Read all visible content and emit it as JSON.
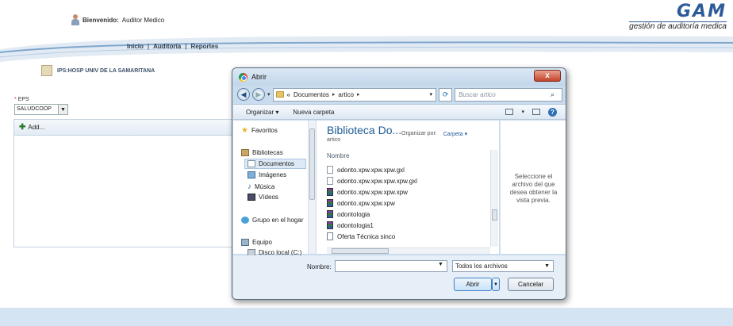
{
  "header": {
    "welcome_label": "Bienvenido:",
    "user_name": "Auditor Medico",
    "brand_logo": "GAM",
    "brand_tagline": "gestión de auditoría medica"
  },
  "nav": {
    "items": [
      "Inicio",
      "Auditoria",
      "Reportes"
    ],
    "separator": "|"
  },
  "ips": {
    "label": "IPS:HOSP UNIV DE LA SAMARITANA"
  },
  "eps": {
    "label": "EPS",
    "required_mark": "*",
    "value": "SALUDCOOP"
  },
  "panel": {
    "add_label": "Add..."
  },
  "dialog": {
    "title": "Abrir",
    "close_label": "x",
    "address": {
      "prefix": "«",
      "crumbs": [
        "Documentos",
        "artico"
      ]
    },
    "search_placeholder": "Buscar artico",
    "toolbar": {
      "organize": "Organizar ▾",
      "new_folder": "Nueva carpeta"
    },
    "nav_pane": {
      "favorites": "Favoritos",
      "libraries": "Bibliotecas",
      "documents": "Documentos",
      "images": "Imágenes",
      "music": "Música",
      "videos": "Vídeos",
      "homegroup": "Grupo en el hogar",
      "computer": "Equipo",
      "local_disk": "Disco local (C:)"
    },
    "library": {
      "title": "Biblioteca Do...",
      "subtitle": "artico",
      "arrange_label": "Organizar por:",
      "arrange_value": "Carpeta ▾"
    },
    "column_header": "Nombre",
    "files": [
      {
        "name": "odonto.xpw.xpw.xpw.gxl",
        "type": "doc"
      },
      {
        "name": "odonto.xpw.xpw.xpw.xpw.gxl",
        "type": "doc"
      },
      {
        "name": "odonto.xpw.xpw.xpw.xpw",
        "type": "rar"
      },
      {
        "name": "odonto.xpw.xpw.xpw",
        "type": "rar"
      },
      {
        "name": "odontologia",
        "type": "rar"
      },
      {
        "name": "odontologia1",
        "type": "rar"
      },
      {
        "name": "Oferta Técnica sinco",
        "type": "word"
      }
    ],
    "preview_text": "Seleccione el archivo del que desea obtener la vista previa.",
    "file_name_label": "Nombre:",
    "file_name_value": "",
    "file_type": "Todos los archivos",
    "open_button": "Abrir",
    "cancel_button": "Cancelar"
  }
}
